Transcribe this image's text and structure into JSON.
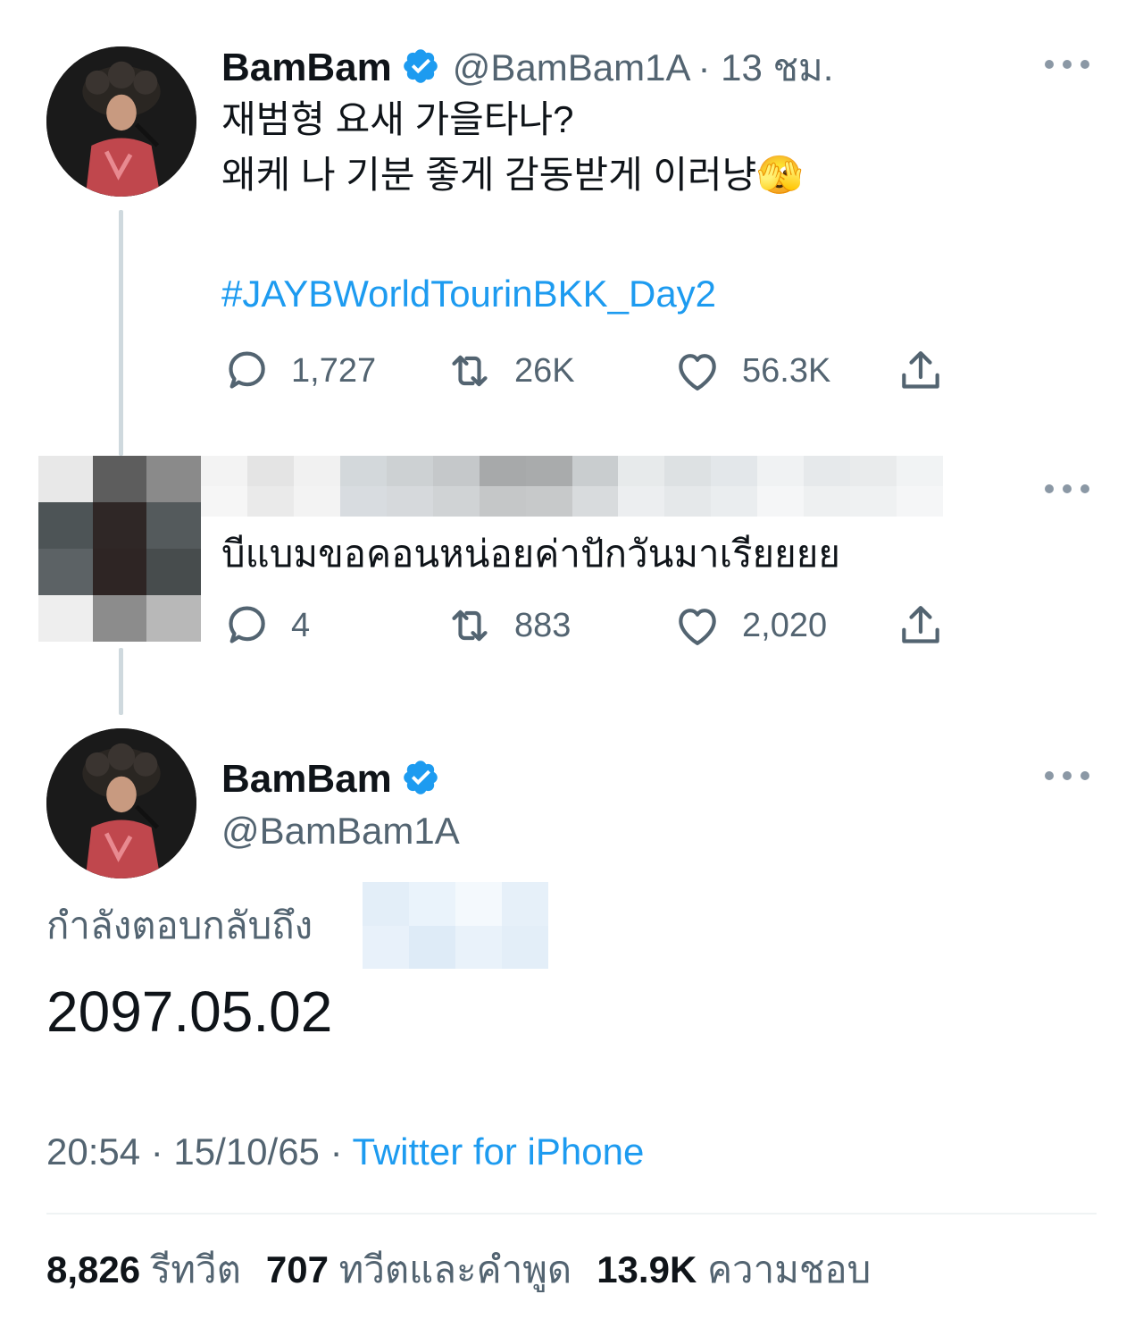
{
  "tweet1": {
    "name": "BamBam",
    "handle": "@BamBam1A",
    "time": "· 13 ชม.",
    "text_line1": "재범형 요새 가을타나?",
    "text_line2": "왜케 나 기분 좋게 감동받게 이러냥",
    "emoji": "🫣",
    "hashtag": "#JAYBWorldTourinBKK_Day2",
    "replies": "1,727",
    "retweets": "26K",
    "likes": "56.3K"
  },
  "tweet2": {
    "text": "บีแบมขอคอนหน่อยค่าปักวันมาเรียยยย",
    "replies": "4",
    "retweets": "883",
    "likes": "2,020"
  },
  "tweet3": {
    "name": "BamBam",
    "handle": "@BamBam1A",
    "replying_to": "กำลังตอบกลับถึง",
    "text": "2097.05.02",
    "time": "20:54 · 15/10/65 ·",
    "source": "Twitter for iPhone",
    "retweet_count": "8,826",
    "retweet_label": "รีทวีต",
    "quote_count": "707",
    "quote_label": "ทวีตและคำพูด",
    "like_count": "13.9K",
    "like_label": "ความชอบ"
  },
  "icons": [
    "reply-icon",
    "retweet-icon",
    "like-icon",
    "share-icon",
    "verified-badge-icon",
    "more-icon"
  ],
  "colors": {
    "accent": "#1d9bf0",
    "text": "#0f1419",
    "secondary": "#536471",
    "thread_line": "#cfd9de"
  }
}
